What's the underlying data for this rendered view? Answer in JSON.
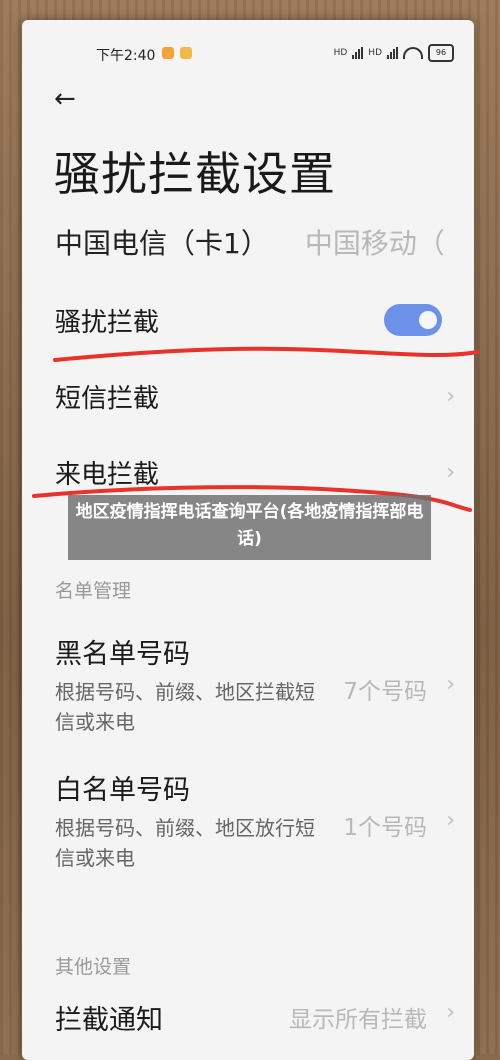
{
  "status": {
    "time": "下午2:40",
    "sim1": "HD",
    "sim2": "HD",
    "battery": "96"
  },
  "page": {
    "title": "骚扰拦截设置"
  },
  "sim_tabs": {
    "active": "中国电信（卡1）",
    "inactive": "中国移动（"
  },
  "settings": {
    "harass_block": {
      "label": "骚扰拦截",
      "enabled": true
    },
    "sms_block": {
      "label": "短信拦截"
    },
    "call_block": {
      "label": "来电拦截"
    }
  },
  "list_management": {
    "header": "名单管理",
    "blacklist": {
      "title": "黑名单号码",
      "desc": "根据号码、前缀、地区拦截短信或来电",
      "value": "7个号码"
    },
    "whitelist": {
      "title": "白名单号码",
      "desc": "根据号码、前缀、地区放行短信或来电",
      "value": "1个号码"
    }
  },
  "other_settings": {
    "header": "其他设置",
    "notify": {
      "title": "拦截通知",
      "value": "显示所有拦截"
    }
  },
  "overlay": {
    "text": "地区疫情指挥电话查询平台(各地疫情指挥部电话)"
  },
  "colors": {
    "accent": "#6b91e8",
    "annotation": "#e8322a"
  }
}
